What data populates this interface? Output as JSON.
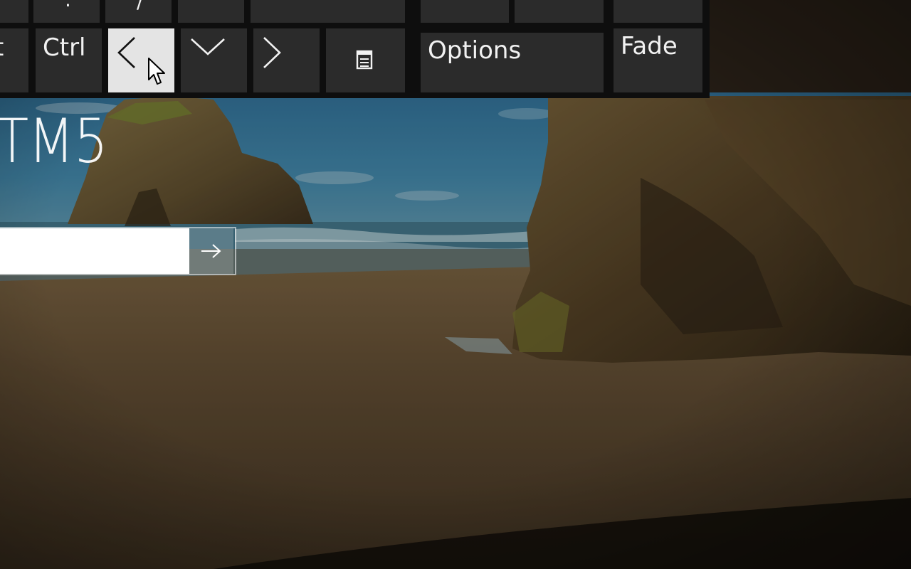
{
  "lock_screen": {
    "user_name": "TM5",
    "password": {
      "value": "",
      "placeholder": ""
    },
    "submit_icon": "arrow-right-icon"
  },
  "keyboard": {
    "top_row": [
      {
        "id": "key-top-1",
        "label": ""
      },
      {
        "id": "key-period",
        "label": "."
      },
      {
        "id": "key-slash",
        "label": "/"
      },
      {
        "id": "key-top-4",
        "label": ""
      },
      {
        "id": "key-top-5",
        "label": ""
      },
      {
        "id": "key-top-6",
        "label": ""
      },
      {
        "id": "key-top-7",
        "label": ""
      },
      {
        "id": "key-top-8",
        "label": ""
      }
    ],
    "bottom_row": {
      "alt_partial": "t",
      "ctrl": "Ctrl",
      "left_arrow_icon": "chevron-left-icon",
      "down_arrow_icon": "chevron-down-icon",
      "right_arrow_icon": "chevron-right-icon",
      "menu_icon": "context-menu-icon",
      "options": "Options",
      "fade": "Fade"
    },
    "pressed_key": "left-arrow"
  },
  "colors": {
    "key_bg": "#2b2b2b",
    "key_pressed_bg": "#e4e4e4",
    "keyboard_bg": "#0e0e0e",
    "text": "#f2f2f2"
  }
}
